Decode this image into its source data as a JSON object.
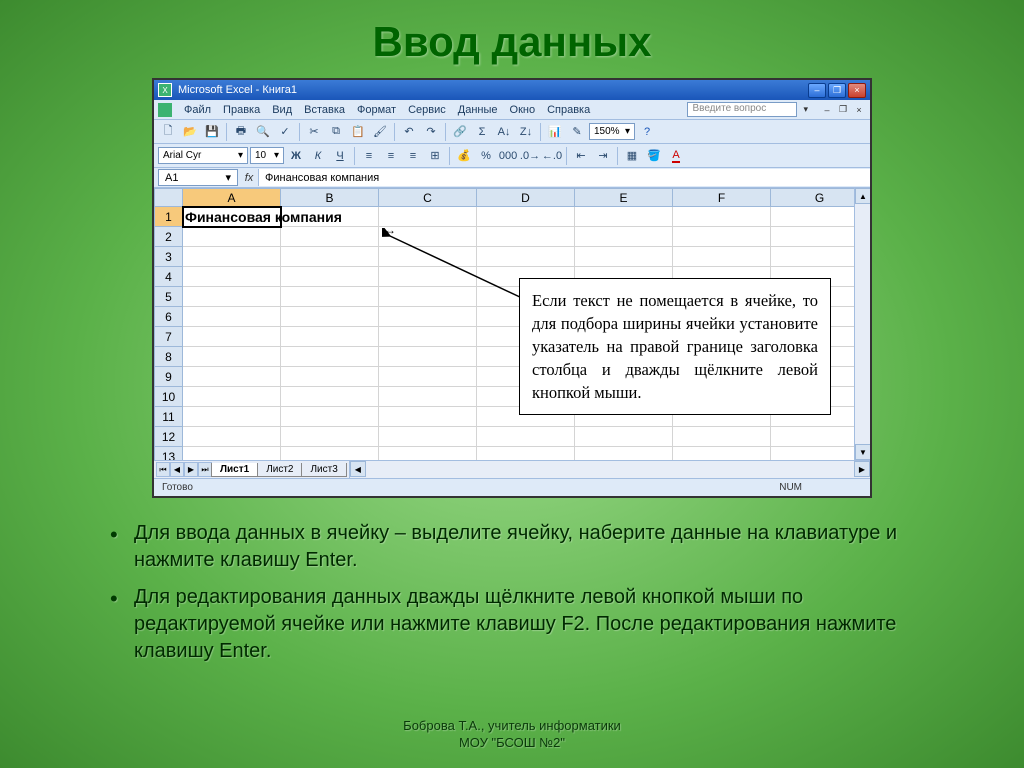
{
  "slide": {
    "title": "Ввод данных",
    "bullets": [
      "Для ввода данных в ячейку – выделите ячейку, наберите данные на клавиатуре и нажмите клавишу Enter.",
      "Для редактирования данных дважды щёлкните левой кнопкой мыши по редактируемой ячейке или нажмите клавишу F2. После редактирования нажмите клавишу Enter."
    ],
    "footer_line1": "Боброва Т.А., учитель информатики",
    "footer_line2": "МОУ \"БСОШ №2\""
  },
  "excel": {
    "titlebar": "Microsoft Excel - Книга1",
    "menu": [
      "Файл",
      "Правка",
      "Вид",
      "Вставка",
      "Формат",
      "Сервис",
      "Данные",
      "Окно",
      "Справка"
    ],
    "help_placeholder": "Введите вопрос",
    "zoom": "150%",
    "font_name": "Arial Cyr",
    "font_size": "10",
    "name_box": "A1",
    "fx": "fx",
    "formula_value": "Финансовая компания",
    "columns": [
      "A",
      "B",
      "C",
      "D",
      "E",
      "F",
      "G"
    ],
    "rows": [
      "1",
      "2",
      "3",
      "4",
      "5",
      "6",
      "7",
      "8",
      "9",
      "10",
      "11",
      "12",
      "13"
    ],
    "cell_A1": "Финансовая компания",
    "sheets": [
      "Лист1",
      "Лист2",
      "Лист3"
    ],
    "status_left": "Готово",
    "status_right": "NUM"
  },
  "callout": {
    "text": "Если текст не помещается в ячейке, то для подбора ширины ячейки установите указатель на правой границе заголовка столбца и дважды щёлкните левой кнопкой мыши."
  }
}
